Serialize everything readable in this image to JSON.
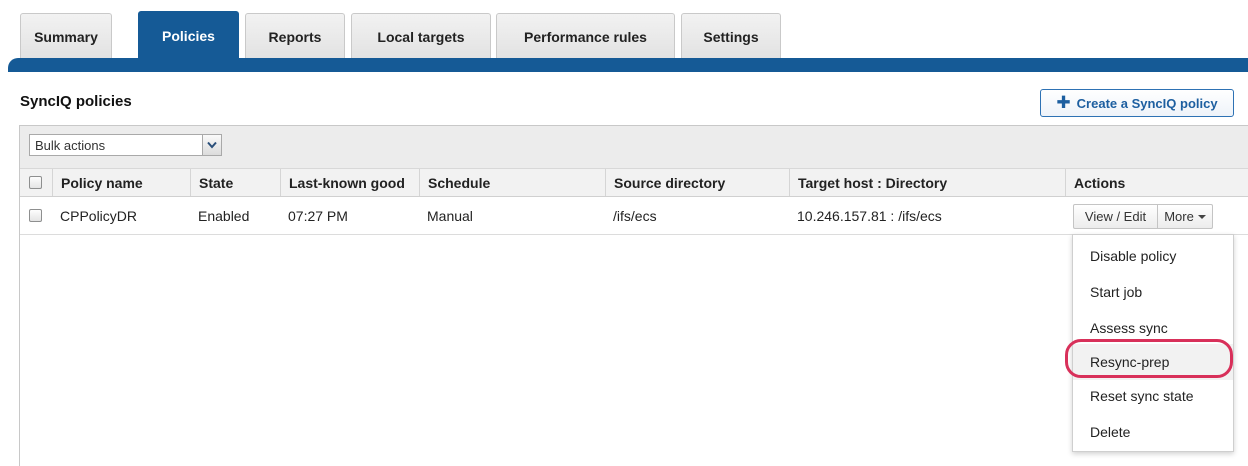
{
  "tabs": [
    {
      "label": "Summary",
      "active": false
    },
    {
      "label": "Policies",
      "active": true
    },
    {
      "label": "Reports",
      "active": false
    },
    {
      "label": "Local targets",
      "active": false
    },
    {
      "label": "Performance rules",
      "active": false
    },
    {
      "label": "Settings",
      "active": false
    }
  ],
  "page_title": "SyncIQ policies",
  "create_button": {
    "label": "Create a SyncIQ policy",
    "icon": "plus-icon"
  },
  "bulk_actions": {
    "selected": "Bulk actions"
  },
  "table": {
    "columns": [
      "Policy name",
      "State",
      "Last-known good",
      "Schedule",
      "Source directory",
      "Target host : Directory",
      "Actions"
    ],
    "rows": [
      {
        "policy_name": "CPPolicyDR",
        "state": "Enabled",
        "last_known_good": "07:27 PM",
        "schedule": "Manual",
        "source_directory": "/ifs/ecs",
        "target": "10.246.157.81 : /ifs/ecs",
        "view_edit": "View / Edit",
        "more": "More"
      }
    ]
  },
  "more_menu": {
    "items": [
      "Disable policy",
      "Start job",
      "Assess sync",
      "Resync-prep",
      "Reset sync state",
      "Delete"
    ],
    "highlighted": "Resync-prep"
  },
  "colors": {
    "accent": "#155a96",
    "highlight_ring": "#d8305a",
    "link": "#1d5fa0"
  }
}
